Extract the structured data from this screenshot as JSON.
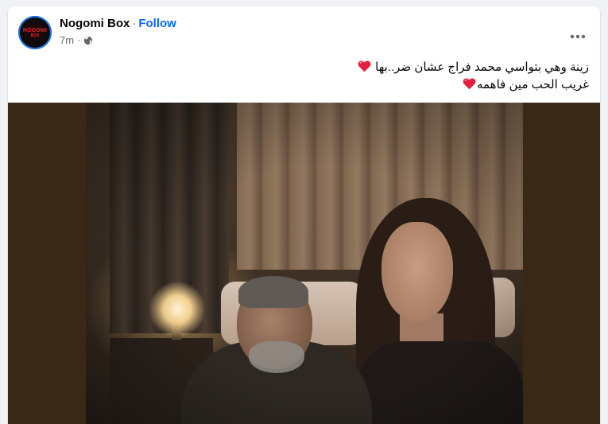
{
  "post": {
    "page_name": "Nogomi Box",
    "separator": "·",
    "follow_label": "Follow",
    "time": "7m",
    "meta_separator": "·",
    "audience_icon": "globe-icon",
    "more_icon": "more-horizontal-icon",
    "avatar_logo": {
      "line1": "NOGOMI",
      "line2": "BOX"
    },
    "caption": {
      "line1": "زينة وهي بتواسي محمد فراج عشان ضر..بها",
      "line2": "غريب الحب مين فاهمه",
      "emoji": "red-heart-icon"
    },
    "photo": {
      "description_icon": "photo-image"
    }
  },
  "colors": {
    "link_blue": "#0866ff",
    "avatar_ring": "#1b74e4",
    "text_primary": "#050505",
    "text_secondary": "#65676b",
    "heart_red": "#e41e3f",
    "photo_backdrop": "#3a2817"
  }
}
